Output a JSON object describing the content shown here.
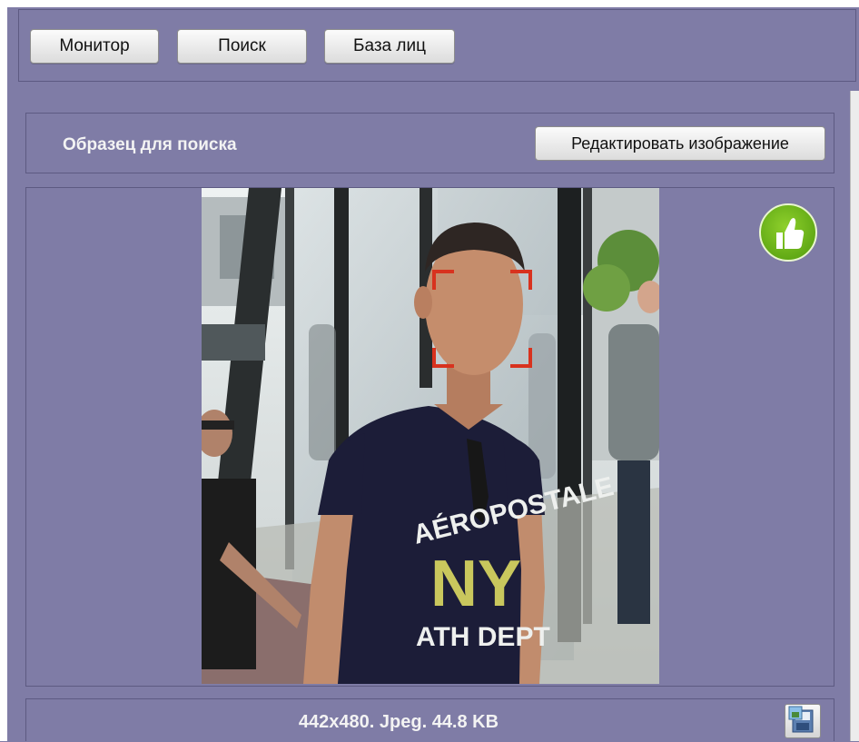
{
  "tabs": {
    "monitor": "Монитор",
    "search": "Поиск",
    "face_base": "База лиц"
  },
  "sample": {
    "title": "Образец для поиска",
    "edit_button": "Редактировать изображение"
  },
  "image": {
    "info": "442x480. Jpeg. 44.8 KB",
    "shirt_text_top": "AÉROPOSTALE",
    "shirt_text_mid": "NY",
    "shirt_text_bottom": "ATH DEPT"
  },
  "icons": {
    "like": "thumbs-up-icon",
    "save": "save-image-icon"
  },
  "colors": {
    "background": "#7f7ca6",
    "like_green": "#6cb81c",
    "face_box": "#d8321e"
  }
}
